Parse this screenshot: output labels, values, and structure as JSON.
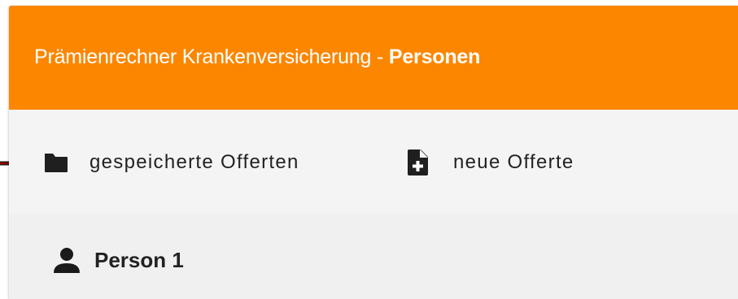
{
  "header": {
    "title_prefix": "Prämienrechner Krankenversicherung - ",
    "title_strong": "Personen",
    "background_color": "#fc8600"
  },
  "toolbar": {
    "items": [
      {
        "label": "gespeicherte Offerten",
        "icon": "folder-icon"
      },
      {
        "label": "neue Offerte",
        "icon": "new-file-icon"
      }
    ]
  },
  "persons": [
    {
      "label": "Person 1",
      "icon": "person-icon"
    }
  ],
  "annotation": {
    "icon": "pointer-arrow-icon",
    "color": "#8b0000"
  }
}
